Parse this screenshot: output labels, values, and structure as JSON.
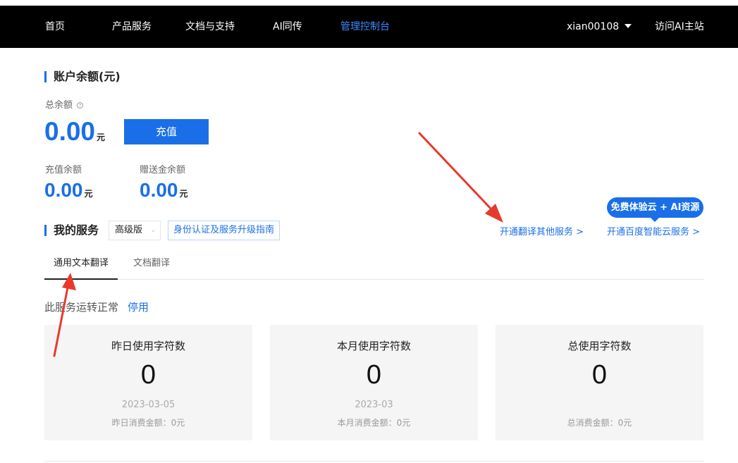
{
  "nav": {
    "items": [
      "首页",
      "产品服务",
      "文档与支持",
      "AI同传",
      "管理控制台"
    ],
    "user": "xian00108",
    "visit_main": "访问AI主站"
  },
  "balance": {
    "section_title": "账户余额(元)",
    "total_label": "总余额",
    "help_icon": "?",
    "total_value": "0.00",
    "unit": "元",
    "recharge_button": "充值",
    "recharge_label": "充值余额",
    "recharge_value": "0.00",
    "gift_label": "赠送金余额",
    "gift_value": "0.00"
  },
  "services": {
    "section_title": "我的服务",
    "edition": "高级版",
    "guide_button": "身份认证及服务升级指南",
    "open_other": "开通翻译其他服务 >",
    "open_baidu_cloud": "开通百度智能云服务 >",
    "promo_badge": "免费体验云 + AI资源",
    "tabs": [
      "通用文本翻译",
      "文档翻译"
    ],
    "status_text": "此服务运转正常",
    "disable_link": "停用"
  },
  "stats": [
    {
      "title": "昨日使用字符数",
      "value": "0",
      "date": "2023-03-05",
      "cost": "昨日消费金额：0元"
    },
    {
      "title": "本月使用字符数",
      "value": "0",
      "date": "2023-03",
      "cost": "本月消费金额：0元"
    },
    {
      "title": "总使用字符数",
      "value": "0",
      "date": "",
      "cost": "总消费金额：0元"
    }
  ],
  "colors": {
    "accent": "#1a6fe8",
    "nav_bg": "#000000",
    "annotation_arrow": "#e8392c"
  }
}
